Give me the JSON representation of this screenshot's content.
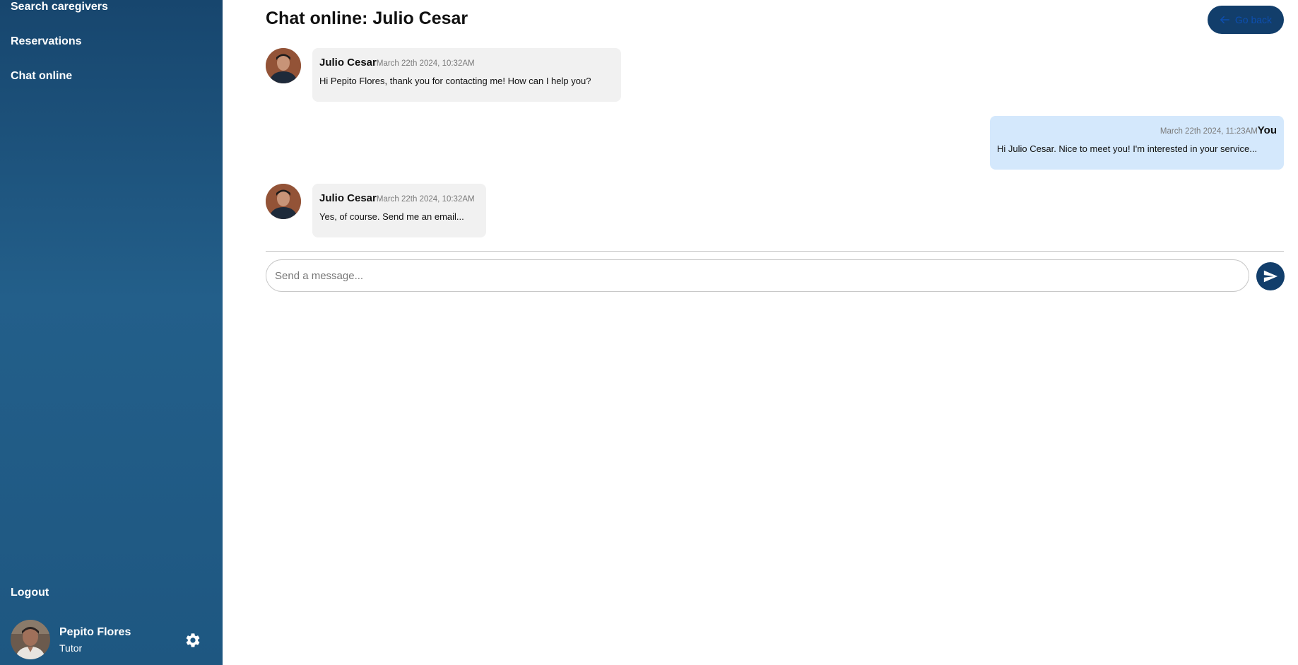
{
  "sidebar": {
    "nav": {
      "search": "Search caregivers",
      "reservations": "Reservations",
      "chat": "Chat online"
    },
    "logout": "Logout",
    "user": {
      "name": "Pepito Flores",
      "role": "Tutor"
    }
  },
  "header": {
    "title": "Chat online: Julio Cesar",
    "back_label": "Go back"
  },
  "messages": [
    {
      "sender": "Julio Cesar",
      "time": "March 22th 2024, 10:32AM",
      "text": "Hi Pepito Flores, thank you for contacting me! How can I help you?"
    },
    {
      "sender": "You",
      "time": "March 22th 2024, 11:23AM",
      "text": "Hi Julio Cesar. Nice to meet you! I'm interested in your service..."
    },
    {
      "sender": "Julio Cesar",
      "time": "March 22th 2024, 10:32AM",
      "text": "Yes, of course. Send me an email..."
    }
  ],
  "composer": {
    "placeholder": "Send a message..."
  },
  "colors": {
    "sidebar_top": "#17466e",
    "sidebar_mid": "#235f8a",
    "accent_dark": "#123e6b",
    "bubble_incoming": "#f1f1f1",
    "bubble_outgoing": "#d4e8fc"
  }
}
